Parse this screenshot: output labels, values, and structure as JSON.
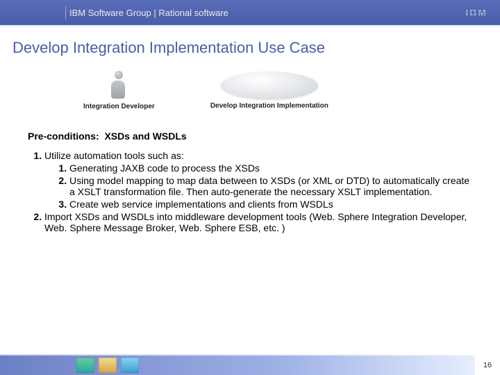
{
  "header": {
    "text": "IBM Software Group | Rational software",
    "logo_text": "IBM"
  },
  "title": "Develop Integration Implementation Use Case",
  "diagram": {
    "actor_label": "Integration Developer",
    "usecase_label": "Develop Integration Implementation"
  },
  "preconditions": {
    "label": "Pre-conditions:",
    "value": "XSDs and WSDLs"
  },
  "steps": {
    "item1": {
      "text": "Utilize automation tools such as:",
      "sub1": "Generating JAXB code to process the XSDs",
      "sub2": "Using model mapping to map data between to XSDs (or XML or DTD) to automatically create a XSLT transformation file.  Then auto-generate the necessary XSLT implementation.",
      "sub3": "Create web service implementations and clients from WSDLs"
    },
    "item2": {
      "text": "Import XSDs and WSDLs into middleware development tools (Web. Sphere Integration Developer, Web. Sphere Message Broker, Web. Sphere ESB, etc. )"
    }
  },
  "footer": {
    "page_number": "16"
  }
}
